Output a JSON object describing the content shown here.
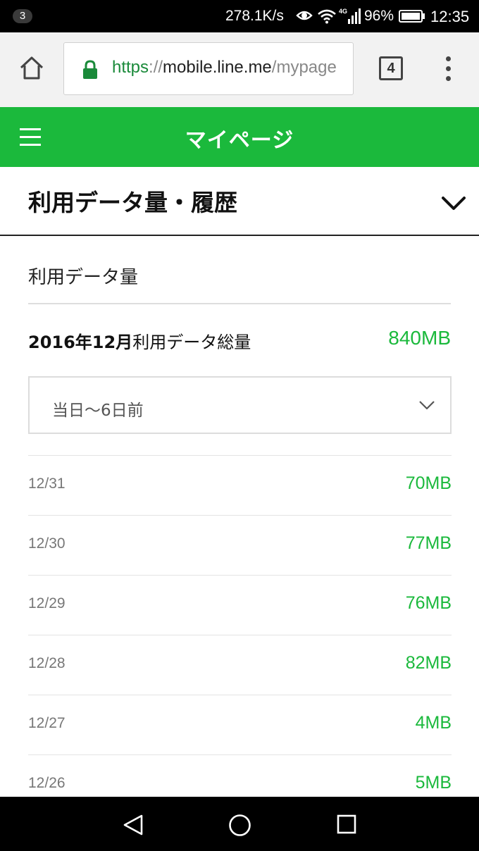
{
  "status_bar": {
    "notification_count": "3",
    "network_speed": "278.1K/s",
    "network_type": "4G",
    "battery_percent": "96%",
    "time": "12:35",
    "icons": [
      "eye-icon",
      "wifi-icon",
      "signal-icon",
      "battery-icon"
    ]
  },
  "browser": {
    "url_scheme": "https",
    "url_separator": "://",
    "url_host": "mobile.line.me",
    "url_path": "/mypage",
    "tab_count": "4",
    "icons": [
      "home-icon",
      "lock-icon",
      "tabs-icon",
      "menu-dots-icon"
    ]
  },
  "header": {
    "title": "マイページ",
    "menu_icon": "hamburger-icon"
  },
  "section": {
    "title": "利用データ量・履歴",
    "toggle_icon": "chevron-down-icon"
  },
  "usage": {
    "subheading": "利用データ量",
    "total_period": "2016年12月",
    "total_label": "利用データ総量",
    "total_value": "840MB",
    "range_selected": "当日〜6日前",
    "rows": [
      {
        "date": "12/31",
        "value": "70MB"
      },
      {
        "date": "12/30",
        "value": "77MB"
      },
      {
        "date": "12/29",
        "value": "76MB"
      },
      {
        "date": "12/28",
        "value": "82MB"
      },
      {
        "date": "12/27",
        "value": "4MB"
      },
      {
        "date": "12/26",
        "value": "5MB"
      }
    ]
  },
  "nav_bar": {
    "icons": [
      "back-icon",
      "home-circle-icon",
      "recents-icon"
    ]
  },
  "colors": {
    "brand_green": "#1bb93c",
    "value_green": "#1bb93c",
    "secure_green": "#1a8a3a"
  }
}
